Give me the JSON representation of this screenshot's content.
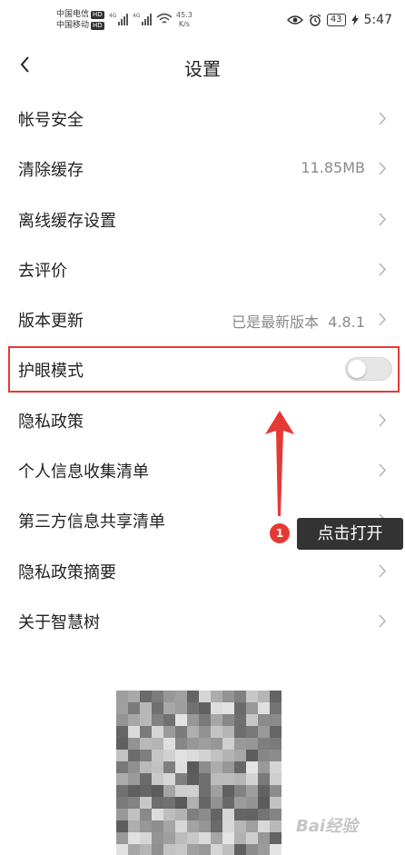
{
  "status_bar": {
    "carrier_1": "中国电信",
    "carrier_2": "中国移动",
    "hd_badge": "HD",
    "signal_label": "4G",
    "net_speed_value": "45.3",
    "net_speed_unit": "K/s",
    "battery": "43",
    "time": "5:47"
  },
  "nav": {
    "title": "设置",
    "back_icon": "chevron-left-icon"
  },
  "settings": {
    "items": [
      {
        "label": "帐号安全",
        "value": ""
      },
      {
        "label": "清除缓存",
        "value": "11.85MB"
      },
      {
        "label": "离线缓存设置",
        "value": ""
      },
      {
        "label": "去评价",
        "value": ""
      },
      {
        "label": "版本更新",
        "value": "已是最新版本  4.8.1"
      },
      {
        "label": "护眼模式",
        "value": "",
        "toggle": false
      },
      {
        "label": "隐私政策",
        "value": ""
      },
      {
        "label": "个人信息收集清单",
        "value": ""
      },
      {
        "label": "第三方信息共享清单",
        "value": ""
      },
      {
        "label": "隐私政策摘要",
        "value": ""
      },
      {
        "label": "关于智慧树",
        "value": ""
      }
    ]
  },
  "annotation": {
    "step_number": "1",
    "tooltip_text": "点击打开",
    "highlight_color": "#e53935",
    "arrow_color": "#e53935"
  },
  "watermark": {
    "text": "Bai经验"
  }
}
